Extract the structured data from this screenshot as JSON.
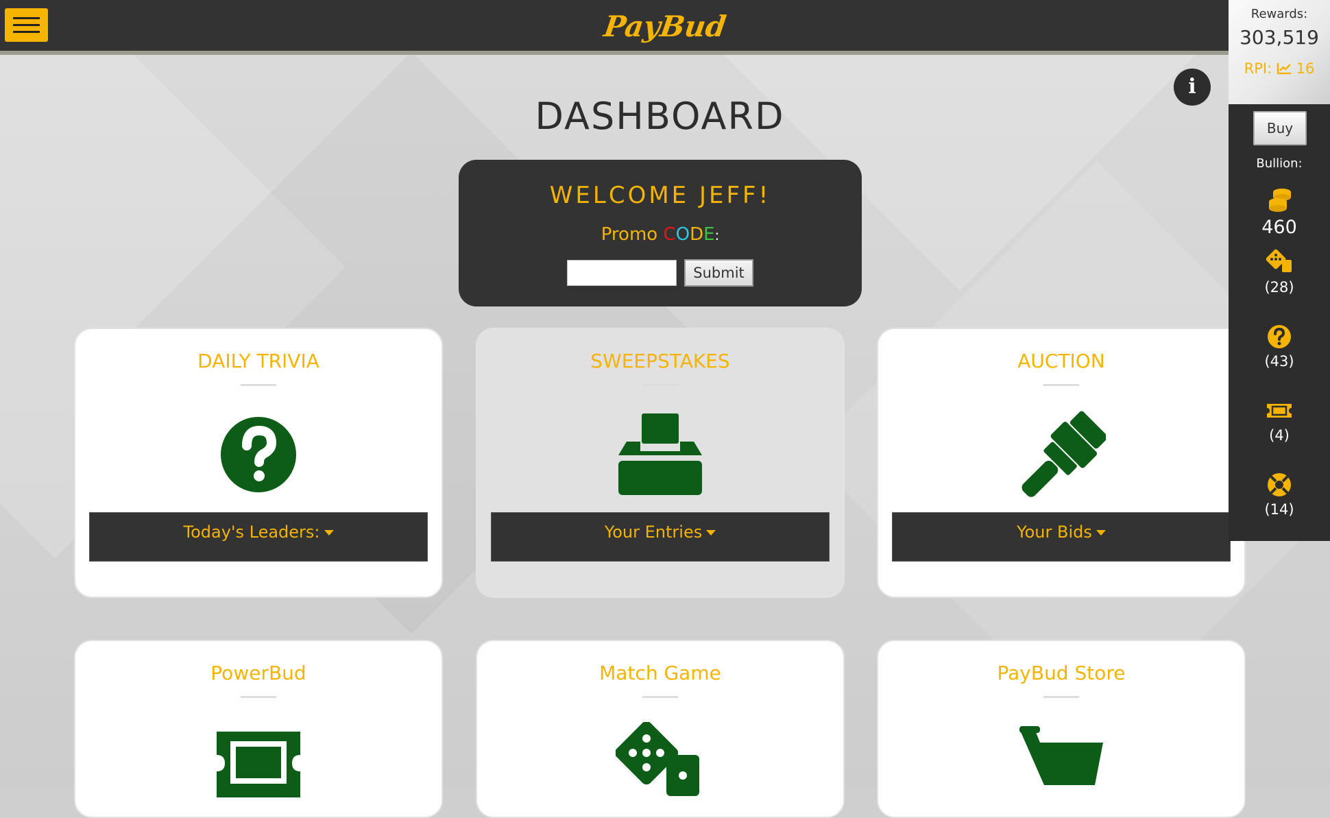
{
  "header": {
    "logo": "PayBud",
    "menu_icon": "hamburger-menu-icon"
  },
  "page": {
    "title": "DASHBOARD",
    "info_icon": "info-icon"
  },
  "welcome": {
    "greeting": "WELCOME JEFF!",
    "promo_prefix": "Promo",
    "promo_letters": [
      "C",
      "O",
      "D",
      "E"
    ],
    "promo_colon": ":",
    "input_value": "",
    "submit_label": "Submit"
  },
  "cards": [
    {
      "title": "DAILY TRIVIA",
      "icon": "question-circle-icon",
      "dropdown": "Today's Leaders:"
    },
    {
      "title": "SWEEPSTAKES",
      "icon": "ballot-box-icon",
      "dropdown": "Your Entries"
    },
    {
      "title": "AUCTION",
      "icon": "gavel-icon",
      "dropdown": "Your Bids"
    },
    {
      "title": "PowerBud",
      "icon": "ticket-icon"
    },
    {
      "title": "Match Game",
      "icon": "dice-icon"
    },
    {
      "title": "PayBud Store",
      "icon": "shopping-cart-icon"
    }
  ],
  "sidebar": {
    "rewards_label": "Rewards:",
    "rewards_value": "303,519",
    "rpi_label": "RPI:",
    "rpi_value": "16",
    "buy_label": "Buy",
    "bullion_label": "Bullion:",
    "items": [
      {
        "icon": "coins-icon",
        "count": "460"
      },
      {
        "icon": "dice-icon",
        "count": "(28)"
      },
      {
        "icon": "question-circle-icon",
        "count": "(43)"
      },
      {
        "icon": "ticket-icon",
        "count": "(4)"
      },
      {
        "icon": "life-ring-icon",
        "count": "(14)"
      }
    ]
  },
  "colors": {
    "accent": "#f4b400",
    "icon_green": "#0d5c17",
    "dark": "#333333"
  }
}
